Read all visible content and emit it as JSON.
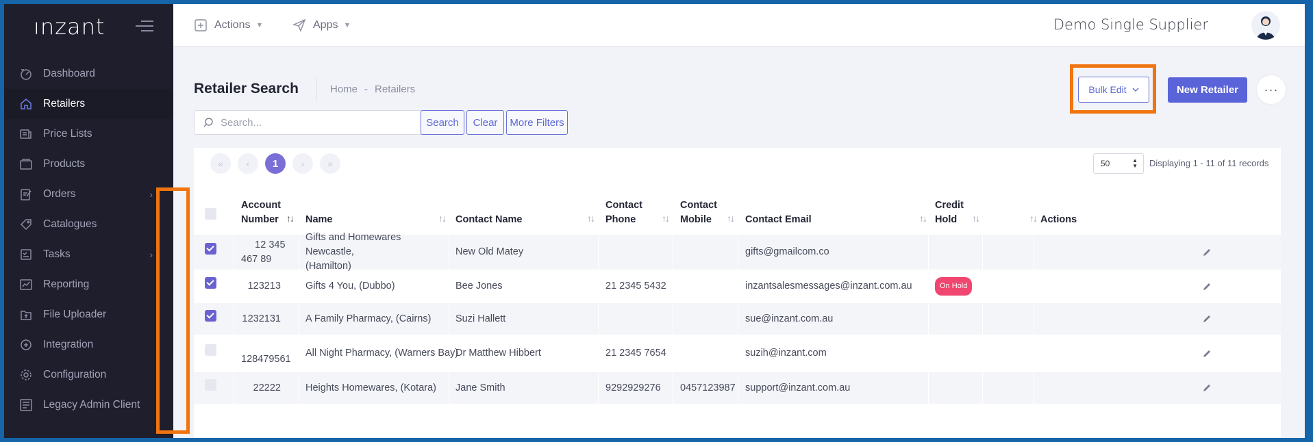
{
  "app": {
    "logo": "ınzant",
    "supplier": "Demo Single Supplier"
  },
  "sidebar": {
    "items": [
      {
        "label": "Dashboard",
        "icon": "dashboard-icon"
      },
      {
        "label": "Retailers",
        "icon": "home-icon",
        "active": true
      },
      {
        "label": "Price Lists",
        "icon": "price-list-icon"
      },
      {
        "label": "Products",
        "icon": "products-icon"
      },
      {
        "label": "Orders",
        "icon": "orders-icon",
        "has_children": true
      },
      {
        "label": "Catalogues",
        "icon": "tag-icon"
      },
      {
        "label": "Tasks",
        "icon": "tasks-icon",
        "has_children": true
      },
      {
        "label": "Reporting",
        "icon": "chart-icon"
      },
      {
        "label": "File Uploader",
        "icon": "upload-icon"
      },
      {
        "label": "Integration",
        "icon": "integration-icon"
      },
      {
        "label": "Configuration",
        "icon": "gear-icon"
      },
      {
        "label": "Legacy Admin Client",
        "icon": "legacy-icon"
      }
    ]
  },
  "topbar": {
    "actions_label": "Actions",
    "apps_label": "Apps"
  },
  "page": {
    "title": "Retailer Search",
    "breadcrumb": [
      "Home",
      "-",
      "Retailers"
    ],
    "bulk_edit_label": "Bulk Edit",
    "new_retailer_label": "New Retailer",
    "more_label": "···"
  },
  "search": {
    "placeholder": "Search...",
    "search_label": "Search",
    "clear_label": "Clear",
    "more_filters_label": "More Filters"
  },
  "pagination": {
    "first": "«",
    "prev": "‹",
    "current": "1",
    "next": "›",
    "last": "»",
    "per_page": "50",
    "display_text": "Displaying 1 - 11 of 11 records"
  },
  "table": {
    "headers": {
      "account_number": [
        "Account",
        "Number"
      ],
      "name": "Name",
      "contact_name": "Contact Name",
      "contact_phone": [
        "Contact",
        "Phone"
      ],
      "contact_mobile": [
        "Contact",
        "Mobile"
      ],
      "contact_email": "Contact Email",
      "credit_hold": [
        "Credit",
        "Hold"
      ],
      "actions": "Actions"
    },
    "rows": [
      {
        "checked": true,
        "account": [
          "12 345",
          "467 89"
        ],
        "name": [
          "Gifts and Homewares Newcastle,",
          "(Hamilton)"
        ],
        "contact": "New Old Matey",
        "phone": "",
        "mobile": "",
        "email": "gifts@gmailcom.co",
        "hold": ""
      },
      {
        "checked": true,
        "account": [
          "123213"
        ],
        "name": [
          "Gifts 4 You, (Dubbo)"
        ],
        "contact": "Bee Jones",
        "phone": "21 2345 5432",
        "mobile": "",
        "email": "inzantsalesmessages@inzant.com.au",
        "hold": "On Hold"
      },
      {
        "checked": true,
        "account": [
          "1232131"
        ],
        "name": [
          "A Family Pharmacy, (Cairns)"
        ],
        "contact": "Suzi Hallett",
        "phone": "",
        "mobile": "",
        "email": "sue@inzant.com.au",
        "hold": ""
      },
      {
        "checked": false,
        "account": [
          "128479561"
        ],
        "name": [
          "All Night Pharmacy, (Warners Bay)"
        ],
        "contact": "Dr Matthew Hibbert",
        "phone": "21 2345 7654",
        "mobile": "",
        "email": "suzih@inzant.com",
        "hold": ""
      },
      {
        "checked": false,
        "account": [
          "22222"
        ],
        "name": [
          "Heights Homewares, (Kotara)"
        ],
        "contact": "Jane Smith",
        "phone": "9292929276",
        "mobile": "0457123987",
        "email": "support@inzant.com.au",
        "hold": ""
      }
    ]
  },
  "colors": {
    "accent": "#5a63d8",
    "sidebar": "#1e1e2d",
    "highlight": "#f07410",
    "hold_badge": "#f0466f"
  }
}
